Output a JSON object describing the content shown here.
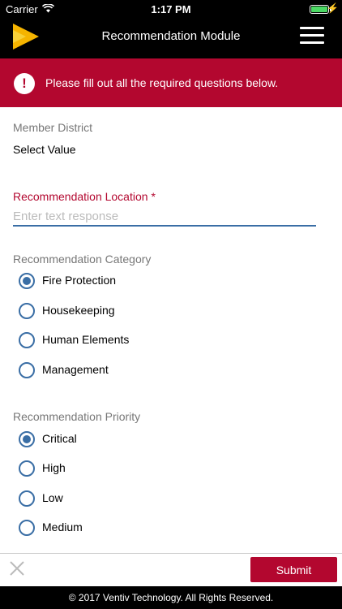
{
  "status_bar": {
    "carrier": "Carrier",
    "time": "1:17 PM"
  },
  "nav": {
    "title": "Recommendation Module",
    "logo_colors": [
      "#f5b400",
      "#f7d038"
    ]
  },
  "banner": {
    "icon": "!",
    "message": "Please fill out all the required questions below.",
    "color": "#b3072f"
  },
  "form": {
    "member_district": {
      "label": "Member District",
      "value": "Select Value"
    },
    "location": {
      "label": "Recommendation Location",
      "required_mark": "*",
      "placeholder": "Enter text response",
      "value": ""
    },
    "category": {
      "label": "Recommendation Category",
      "options": [
        {
          "label": "Fire Protection",
          "checked": true
        },
        {
          "label": "Housekeeping",
          "checked": false
        },
        {
          "label": "Human Elements",
          "checked": false
        },
        {
          "label": "Management",
          "checked": false
        }
      ]
    },
    "priority": {
      "label": "Recommendation Priority",
      "options": [
        {
          "label": "Critical",
          "checked": true
        },
        {
          "label": "High",
          "checked": false
        },
        {
          "label": "Low",
          "checked": false
        },
        {
          "label": "Medium",
          "checked": false
        }
      ]
    }
  },
  "toolbar": {
    "submit_label": "Submit"
  },
  "footer": {
    "text": "© 2017 Ventiv Technology. All Rights Reserved."
  },
  "colors": {
    "accent": "#3a6ea5",
    "brand_red": "#b3072f"
  }
}
